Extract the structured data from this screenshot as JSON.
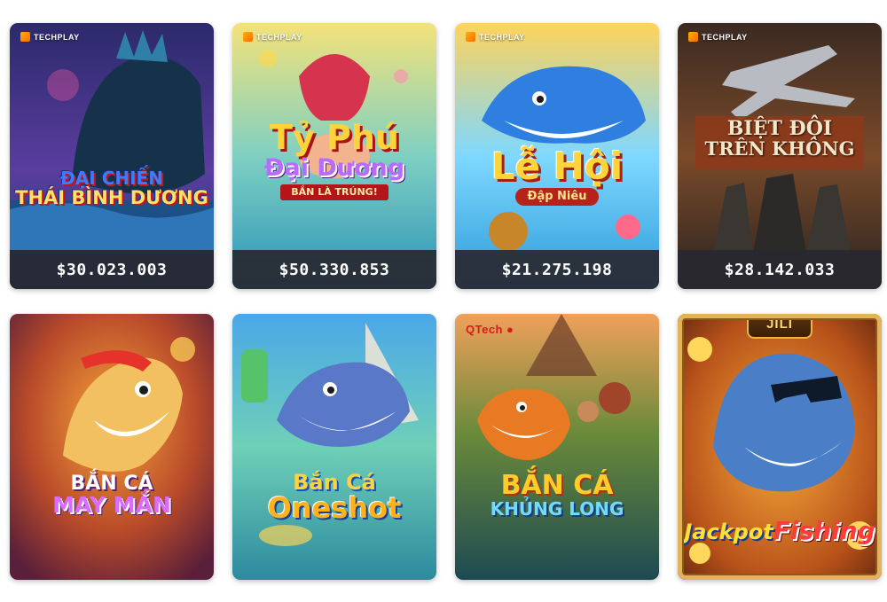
{
  "games": [
    {
      "id": "dai-chien-thai-binh-duong",
      "provider": "TECHPLAY",
      "title_lines": [
        "ĐẠI CHIẾN",
        "THÁI BÌNH DƯƠNG"
      ],
      "jackpot": "$30.023.003",
      "accent": "#2a6fd6"
    },
    {
      "id": "ty-phu-dai-duong",
      "provider": "TECHPLAY",
      "title_lines": [
        "Tỷ Phú",
        "Đại Dương"
      ],
      "subtitle": "BẮN LÀ TRÚNG!",
      "jackpot": "$50.330.853",
      "accent": "#f0b21a"
    },
    {
      "id": "le-hoi-dap-nieu",
      "provider": "TECHPLAY",
      "title_lines": [
        "Lễ Hội"
      ],
      "subtitle": "Đập Niêu",
      "jackpot": "$21.275.198",
      "accent": "#f5a623"
    },
    {
      "id": "biet-doi-tren-khong",
      "provider": "TECHPLAY",
      "title_lines": [
        "BIỆT ĐỘI",
        "TRÊN KHÔNG"
      ],
      "jackpot": "$28.142.033",
      "accent": "#7a3a1c"
    },
    {
      "id": "ban-ca-may-man",
      "provider": "",
      "title_lines": [
        "BẮN CÁ",
        "MAY MẮN"
      ],
      "accent": "#c04dd6"
    },
    {
      "id": "ban-ca-oneshot",
      "provider": "",
      "title_lines": [
        "Bắn Cá",
        "Oneshot"
      ],
      "accent": "#ffb21a"
    },
    {
      "id": "ban-ca-khung-long",
      "provider": "QTech",
      "title_lines": [
        "BẮN CÁ",
        "KHỦNG LONG"
      ],
      "accent": "#2fb3e6"
    },
    {
      "id": "jackpot-fishing",
      "provider": "JILI",
      "title_lines": [
        "Jackpot",
        "Fishing"
      ],
      "accent": "#ff3b3b"
    }
  ]
}
